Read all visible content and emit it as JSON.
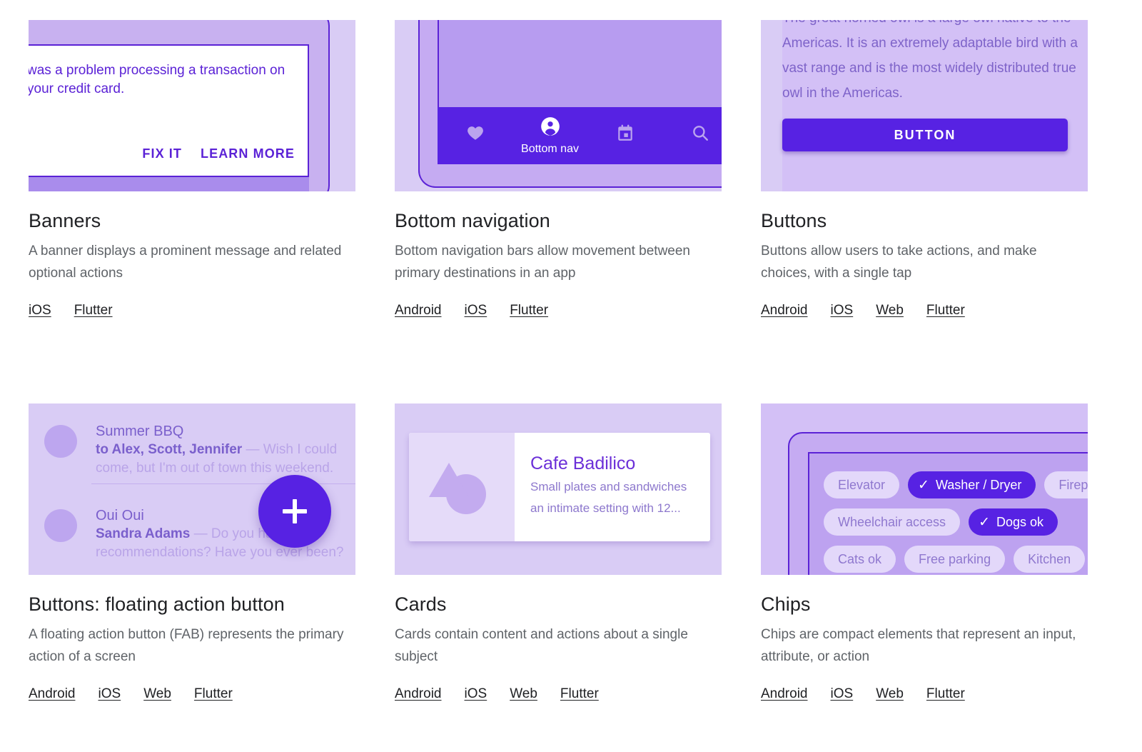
{
  "accent": "#5722e3",
  "surface": "#d9ccf5",
  "cards": [
    {
      "id": "banners",
      "title": "Banners",
      "description": "A banner displays a prominent message and related optional actions",
      "links": [
        "iOS",
        "Flutter"
      ],
      "preview": {
        "body": "was a problem processing a transaction on your credit card.",
        "actions": [
          "FIX IT",
          "LEARN MORE"
        ]
      }
    },
    {
      "id": "bottom-navigation",
      "title": "Bottom navigation",
      "description": "Bottom navigation bars allow movement between primary destinations in an app",
      "links": [
        "Android",
        "iOS",
        "Flutter"
      ],
      "preview": {
        "items": [
          {
            "icon": "heart-icon",
            "label": "",
            "active": false
          },
          {
            "icon": "person-icon",
            "label": "Bottom nav",
            "active": true
          },
          {
            "icon": "calendar-icon",
            "label": "",
            "active": false
          },
          {
            "icon": "search-icon",
            "label": "",
            "active": false
          }
        ]
      }
    },
    {
      "id": "buttons",
      "title": "Buttons",
      "description": "Buttons allow users to take actions, and make choices, with a single tap",
      "links": [
        "Android",
        "iOS",
        "Web",
        "Flutter"
      ],
      "preview": {
        "paragraph": "The great horned owl is a large owl native to the Americas. It is an extremely adaptable bird with a vast range and is the most widely distributed true owl in the Americas.",
        "button_label": "BUTTON"
      }
    },
    {
      "id": "buttons-floating-action-button",
      "title": "Buttons: floating action button",
      "description": "A floating action button (FAB) represents the primary action of a screen",
      "links": [
        "Android",
        "iOS",
        "Web",
        "Flutter"
      ],
      "preview": {
        "rows": [
          {
            "subject": "Summer BBQ",
            "sender": "to Alex, Scott, Jennifer",
            "snippet": "— Wish I could come, but I'm out of town this weekend."
          },
          {
            "subject": "Oui Oui",
            "sender": "Sandra Adams",
            "snippet": "— Do you have recommendations? Have you ever been?"
          }
        ],
        "fab_icon": "plus-icon"
      }
    },
    {
      "id": "cards",
      "title": "Cards",
      "description": "Cards contain content and actions about a single subject",
      "links": [
        "Android",
        "iOS",
        "Web",
        "Flutter"
      ],
      "preview": {
        "card_title": "Cafe Badilico",
        "card_line1": "Small plates and sandwiches",
        "card_line2": "an intimate setting with 12...",
        "thumb_icon": "shapes-icon"
      }
    },
    {
      "id": "chips",
      "title": "Chips",
      "description": "Chips are compact elements that represent an input, attribute, or action",
      "links": [
        "Android",
        "iOS",
        "Web",
        "Flutter"
      ],
      "preview": {
        "chips": [
          {
            "label": "Elevator",
            "selected": false
          },
          {
            "label": "Washer / Dryer",
            "selected": true
          },
          {
            "label": "Fireplace",
            "selected": false
          },
          {
            "label": "Wheelchair access",
            "selected": false
          },
          {
            "label": "Dogs ok",
            "selected": true
          },
          {
            "label": "Cats ok",
            "selected": false
          },
          {
            "label": "Free parking",
            "selected": false
          },
          {
            "label": "Kitchen",
            "selected": false
          }
        ]
      }
    }
  ]
}
